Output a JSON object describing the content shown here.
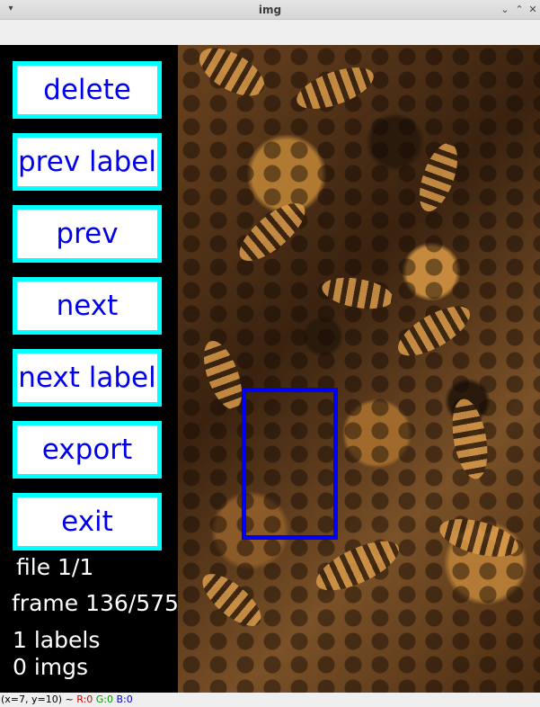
{
  "window": {
    "title": "img",
    "menu_icon": "dropdown-arrow-icon",
    "minimize_icon": "minimize-icon",
    "maximize_icon": "maximize-icon",
    "close_icon": "close-icon"
  },
  "sidebar": {
    "buttons": [
      {
        "label": "delete"
      },
      {
        "label": "prev label"
      },
      {
        "label": "prev"
      },
      {
        "label": "next"
      },
      {
        "label": "next label"
      },
      {
        "label": "export"
      },
      {
        "label": "exit"
      }
    ]
  },
  "info": {
    "file": "file 1/1",
    "frame": "frame 136/575",
    "labels": "1 labels",
    "imgs": "0 imgs"
  },
  "status": {
    "coords": "(x=7, y=10) ~ ",
    "r": "R:0",
    "g": "G:0",
    "b": "B:0"
  },
  "colors": {
    "button_border": "#00ffff",
    "button_text": "#0000ee",
    "label_box": "#0000ff"
  }
}
